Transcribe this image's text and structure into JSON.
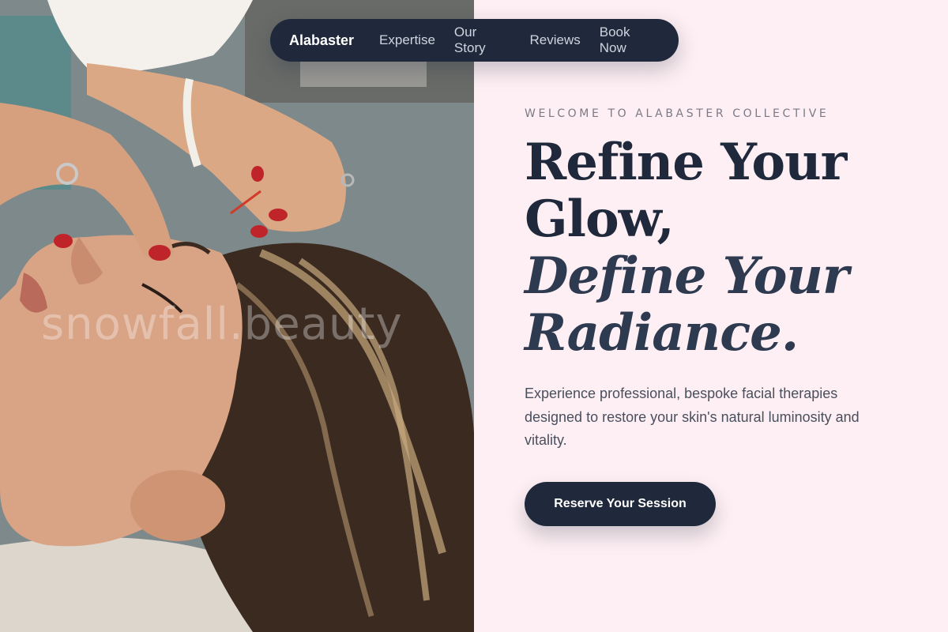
{
  "nav": {
    "brand": "Alabaster",
    "links": [
      "Expertise",
      "Our Story",
      "Reviews",
      "Book Now"
    ]
  },
  "hero": {
    "eyebrow": "WELCOME TO ALABASTER COLLECTIVE",
    "headline_lines": [
      "Refine Your",
      "Glow,",
      "Define Your",
      "Radiance."
    ],
    "lead": "Experience professional, bespoke facial therapies designed to restore your skin's natural luminosity and vitality.",
    "cta_label": "Reserve Your Session"
  },
  "photo": {
    "watermark": "snowfall.beauty",
    "alt": "facial-acupuncture-treatment-photo"
  },
  "colors": {
    "navy": "#1f293b",
    "blush_background": "#fdeff3",
    "muted_text": "#7c7a86"
  }
}
